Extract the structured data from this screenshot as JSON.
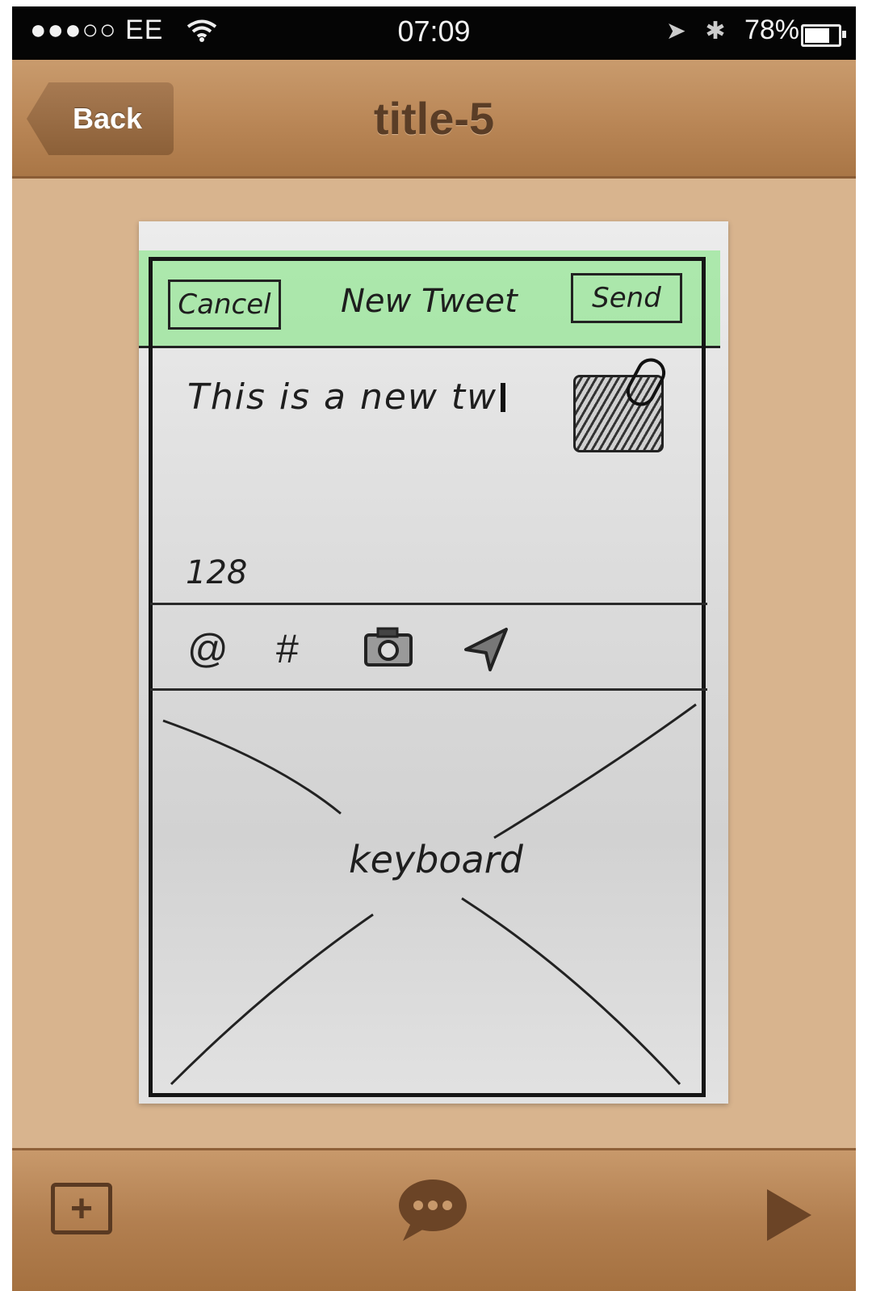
{
  "status_bar": {
    "carrier": "●●●○○ EE",
    "wifi_icon": "wifi-icon",
    "time": "07:09",
    "battery_percent": "78%",
    "battery_level": 0.78
  },
  "nav": {
    "back_label": "Back",
    "title": "title-5"
  },
  "sketch": {
    "cancel_label": "Cancel",
    "header_title": "New Tweet",
    "send_label": "Send",
    "tweet_text": "This is a new tw",
    "char_count": "128",
    "tools": [
      "@",
      "#",
      "camera-icon",
      "send-arrow-icon"
    ],
    "keyboard_label": "keyboard",
    "header_highlight_color": "#78e678"
  },
  "toolbar": {
    "add_icon": "add-square-icon",
    "comment_icon": "comment-bubble-icon",
    "play_icon": "play-icon"
  }
}
